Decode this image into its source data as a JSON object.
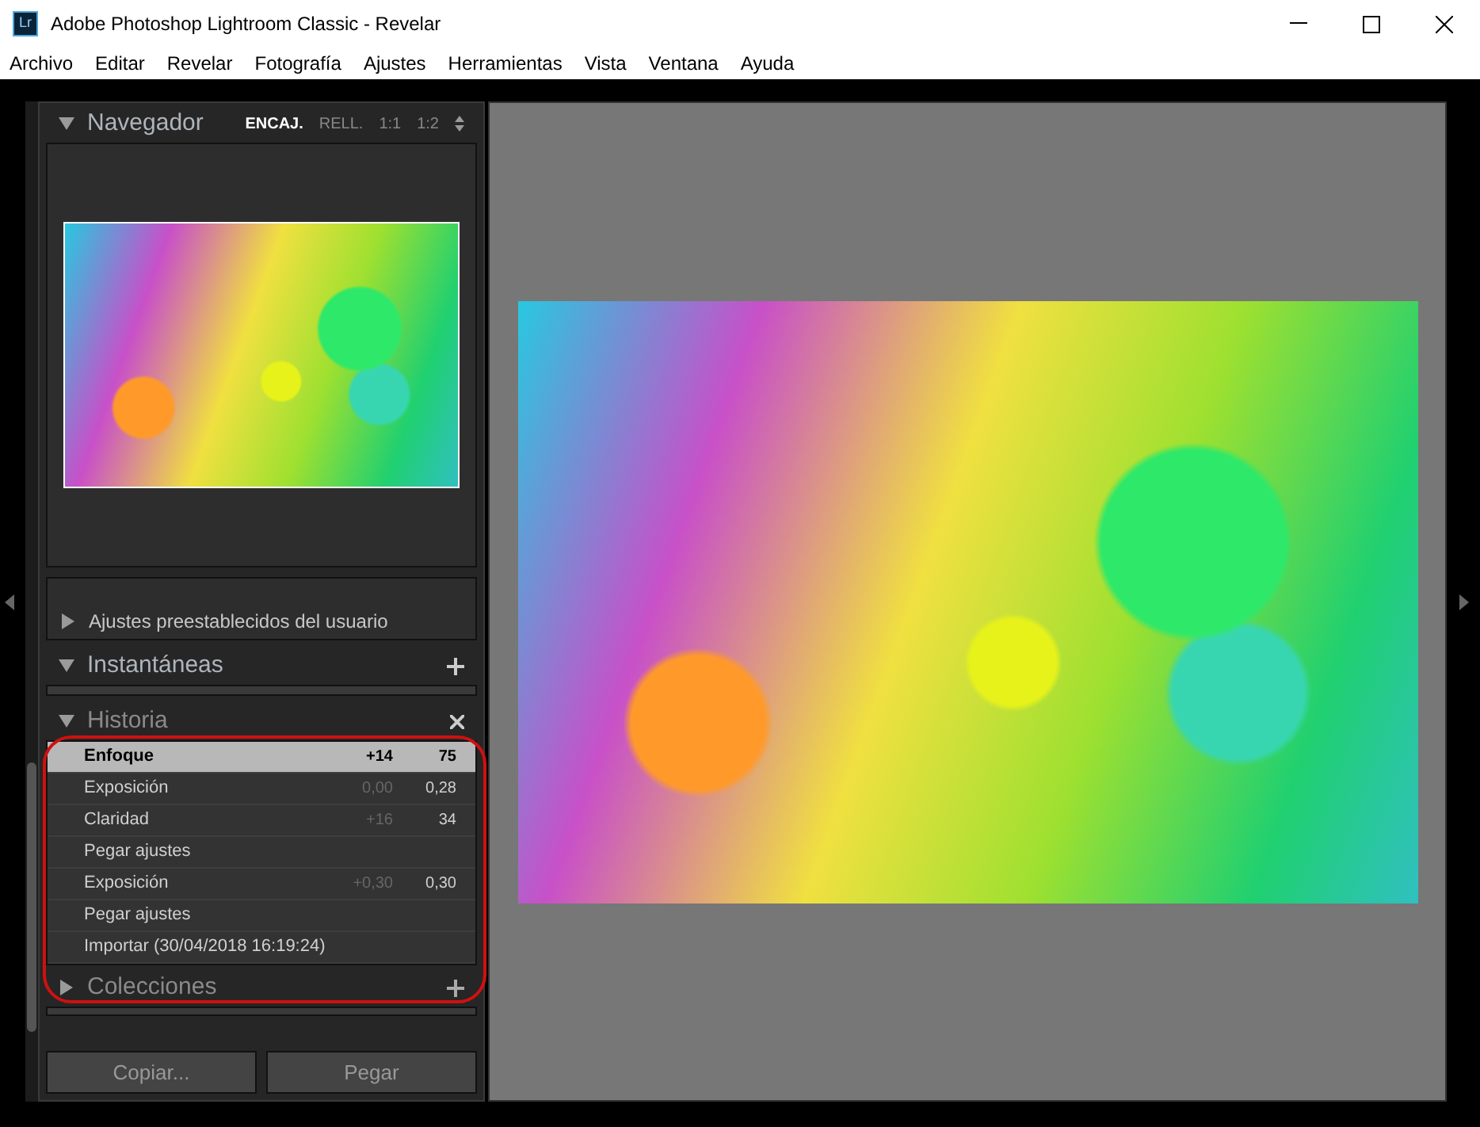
{
  "window": {
    "title": "Adobe Photoshop Lightroom Classic - Revelar",
    "app_badge": "Lr"
  },
  "menu": [
    "Archivo",
    "Editar",
    "Revelar",
    "Fotografía",
    "Ajustes",
    "Herramientas",
    "Vista",
    "Ventana",
    "Ayuda"
  ],
  "navigator": {
    "title": "Navegador",
    "expanded": true,
    "zoom_options": [
      {
        "label": "ENCAJ.",
        "selected": true
      },
      {
        "label": "RELL.",
        "selected": false
      },
      {
        "label": "1:1",
        "selected": false
      },
      {
        "label": "1:2",
        "selected": false
      }
    ]
  },
  "presets": {
    "label": "Ajustes preestablecidos del usuario",
    "expanded": false
  },
  "snapshots": {
    "title": "Instantáneas",
    "expanded": true
  },
  "history": {
    "title": "Historia",
    "expanded": true,
    "items": [
      {
        "name": "Enfoque",
        "before": "+14",
        "after": "75",
        "selected": true
      },
      {
        "name": "Exposición",
        "before": "0,00",
        "after": "0,28",
        "selected": false
      },
      {
        "name": "Claridad",
        "before": "+16",
        "after": "34",
        "selected": false
      },
      {
        "name": "Pegar ajustes",
        "selected": false
      },
      {
        "name": "Exposición",
        "before": "+0,30",
        "after": "0,30",
        "selected": false
      },
      {
        "name": "Pegar ajustes",
        "selected": false
      },
      {
        "name": "Importar (30/04/2018 16:19:24)",
        "selected": false
      }
    ]
  },
  "collections": {
    "title": "Colecciones",
    "expanded": false
  },
  "buttons": [
    "Copiar...",
    "Pegar"
  ]
}
